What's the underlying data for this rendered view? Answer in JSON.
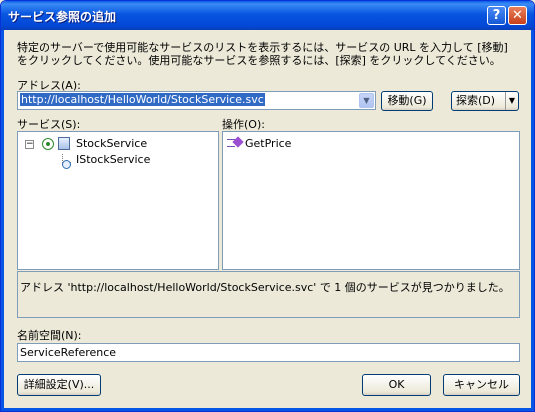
{
  "window": {
    "title": "サービス参照の追加",
    "help_glyph": "?",
    "close_glyph": "✕"
  },
  "description": "特定のサーバーで使用可能なサービスのリストを表示するには、サービスの URL を入力して [移動] をクリックしてください。使用可能なサービスを参照するには、[探索] をクリックしてください。",
  "address": {
    "label": "アドレス(A):",
    "value": "http://localhost/HelloWorld/StockService.svc",
    "go_button": "移動(G)",
    "discover_button": "探索(D)"
  },
  "services": {
    "label": "サービス(S):",
    "tree": [
      {
        "label": "StockService",
        "expanded": true
      },
      {
        "label": "IStockService"
      }
    ]
  },
  "operations": {
    "label": "操作(O):",
    "items": [
      "GetPrice"
    ]
  },
  "status_text": "アドレス 'http://localhost/HelloWorld/StockService.svc' で 1 個のサービスが見つかりました。",
  "namespace": {
    "label": "名前空間(N):",
    "value": "ServiceReference"
  },
  "buttons": {
    "advanced": "詳細設定(V)...",
    "ok": "OK",
    "cancel": "キャンセル"
  },
  "colors": {
    "title_bar": "#0a5de8",
    "selection": "#316ac5",
    "dialog_bg": "#ece9d8",
    "border": "#7f9db9"
  }
}
